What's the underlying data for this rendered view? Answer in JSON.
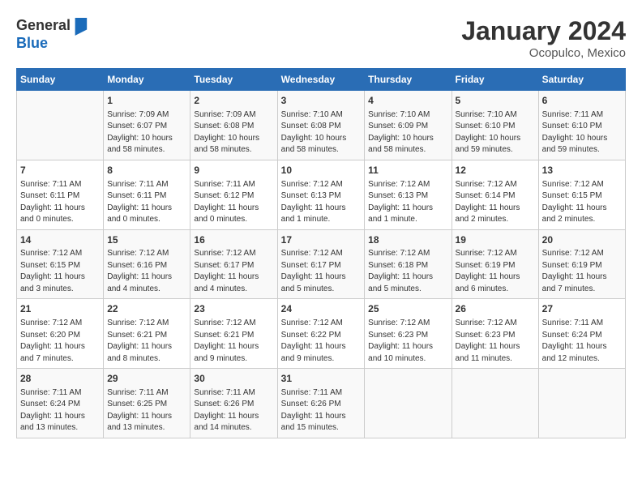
{
  "logo": {
    "general": "General",
    "blue": "Blue"
  },
  "header": {
    "month": "January 2024",
    "location": "Ocopulco, Mexico"
  },
  "weekdays": [
    "Sunday",
    "Monday",
    "Tuesday",
    "Wednesday",
    "Thursday",
    "Friday",
    "Saturday"
  ],
  "weeks": [
    [
      null,
      {
        "day": 1,
        "sunrise": "7:09 AM",
        "sunset": "6:07 PM",
        "daylight": "10 hours and 58 minutes."
      },
      {
        "day": 2,
        "sunrise": "7:09 AM",
        "sunset": "6:08 PM",
        "daylight": "10 hours and 58 minutes."
      },
      {
        "day": 3,
        "sunrise": "7:10 AM",
        "sunset": "6:08 PM",
        "daylight": "10 hours and 58 minutes."
      },
      {
        "day": 4,
        "sunrise": "7:10 AM",
        "sunset": "6:09 PM",
        "daylight": "10 hours and 58 minutes."
      },
      {
        "day": 5,
        "sunrise": "7:10 AM",
        "sunset": "6:10 PM",
        "daylight": "10 hours and 59 minutes."
      },
      {
        "day": 6,
        "sunrise": "7:11 AM",
        "sunset": "6:10 PM",
        "daylight": "10 hours and 59 minutes."
      }
    ],
    [
      {
        "day": 7,
        "sunrise": "7:11 AM",
        "sunset": "6:11 PM",
        "daylight": "11 hours and 0 minutes."
      },
      {
        "day": 8,
        "sunrise": "7:11 AM",
        "sunset": "6:11 PM",
        "daylight": "11 hours and 0 minutes."
      },
      {
        "day": 9,
        "sunrise": "7:11 AM",
        "sunset": "6:12 PM",
        "daylight": "11 hours and 0 minutes."
      },
      {
        "day": 10,
        "sunrise": "7:12 AM",
        "sunset": "6:13 PM",
        "daylight": "11 hours and 1 minute."
      },
      {
        "day": 11,
        "sunrise": "7:12 AM",
        "sunset": "6:13 PM",
        "daylight": "11 hours and 1 minute."
      },
      {
        "day": 12,
        "sunrise": "7:12 AM",
        "sunset": "6:14 PM",
        "daylight": "11 hours and 2 minutes."
      },
      {
        "day": 13,
        "sunrise": "7:12 AM",
        "sunset": "6:15 PM",
        "daylight": "11 hours and 2 minutes."
      }
    ],
    [
      {
        "day": 14,
        "sunrise": "7:12 AM",
        "sunset": "6:15 PM",
        "daylight": "11 hours and 3 minutes."
      },
      {
        "day": 15,
        "sunrise": "7:12 AM",
        "sunset": "6:16 PM",
        "daylight": "11 hours and 4 minutes."
      },
      {
        "day": 16,
        "sunrise": "7:12 AM",
        "sunset": "6:17 PM",
        "daylight": "11 hours and 4 minutes."
      },
      {
        "day": 17,
        "sunrise": "7:12 AM",
        "sunset": "6:17 PM",
        "daylight": "11 hours and 5 minutes."
      },
      {
        "day": 18,
        "sunrise": "7:12 AM",
        "sunset": "6:18 PM",
        "daylight": "11 hours and 5 minutes."
      },
      {
        "day": 19,
        "sunrise": "7:12 AM",
        "sunset": "6:19 PM",
        "daylight": "11 hours and 6 minutes."
      },
      {
        "day": 20,
        "sunrise": "7:12 AM",
        "sunset": "6:19 PM",
        "daylight": "11 hours and 7 minutes."
      }
    ],
    [
      {
        "day": 21,
        "sunrise": "7:12 AM",
        "sunset": "6:20 PM",
        "daylight": "11 hours and 7 minutes."
      },
      {
        "day": 22,
        "sunrise": "7:12 AM",
        "sunset": "6:21 PM",
        "daylight": "11 hours and 8 minutes."
      },
      {
        "day": 23,
        "sunrise": "7:12 AM",
        "sunset": "6:21 PM",
        "daylight": "11 hours and 9 minutes."
      },
      {
        "day": 24,
        "sunrise": "7:12 AM",
        "sunset": "6:22 PM",
        "daylight": "11 hours and 9 minutes."
      },
      {
        "day": 25,
        "sunrise": "7:12 AM",
        "sunset": "6:23 PM",
        "daylight": "11 hours and 10 minutes."
      },
      {
        "day": 26,
        "sunrise": "7:12 AM",
        "sunset": "6:23 PM",
        "daylight": "11 hours and 11 minutes."
      },
      {
        "day": 27,
        "sunrise": "7:11 AM",
        "sunset": "6:24 PM",
        "daylight": "11 hours and 12 minutes."
      }
    ],
    [
      {
        "day": 28,
        "sunrise": "7:11 AM",
        "sunset": "6:24 PM",
        "daylight": "11 hours and 13 minutes."
      },
      {
        "day": 29,
        "sunrise": "7:11 AM",
        "sunset": "6:25 PM",
        "daylight": "11 hours and 13 minutes."
      },
      {
        "day": 30,
        "sunrise": "7:11 AM",
        "sunset": "6:26 PM",
        "daylight": "11 hours and 14 minutes."
      },
      {
        "day": 31,
        "sunrise": "7:11 AM",
        "sunset": "6:26 PM",
        "daylight": "11 hours and 15 minutes."
      },
      null,
      null,
      null
    ]
  ]
}
